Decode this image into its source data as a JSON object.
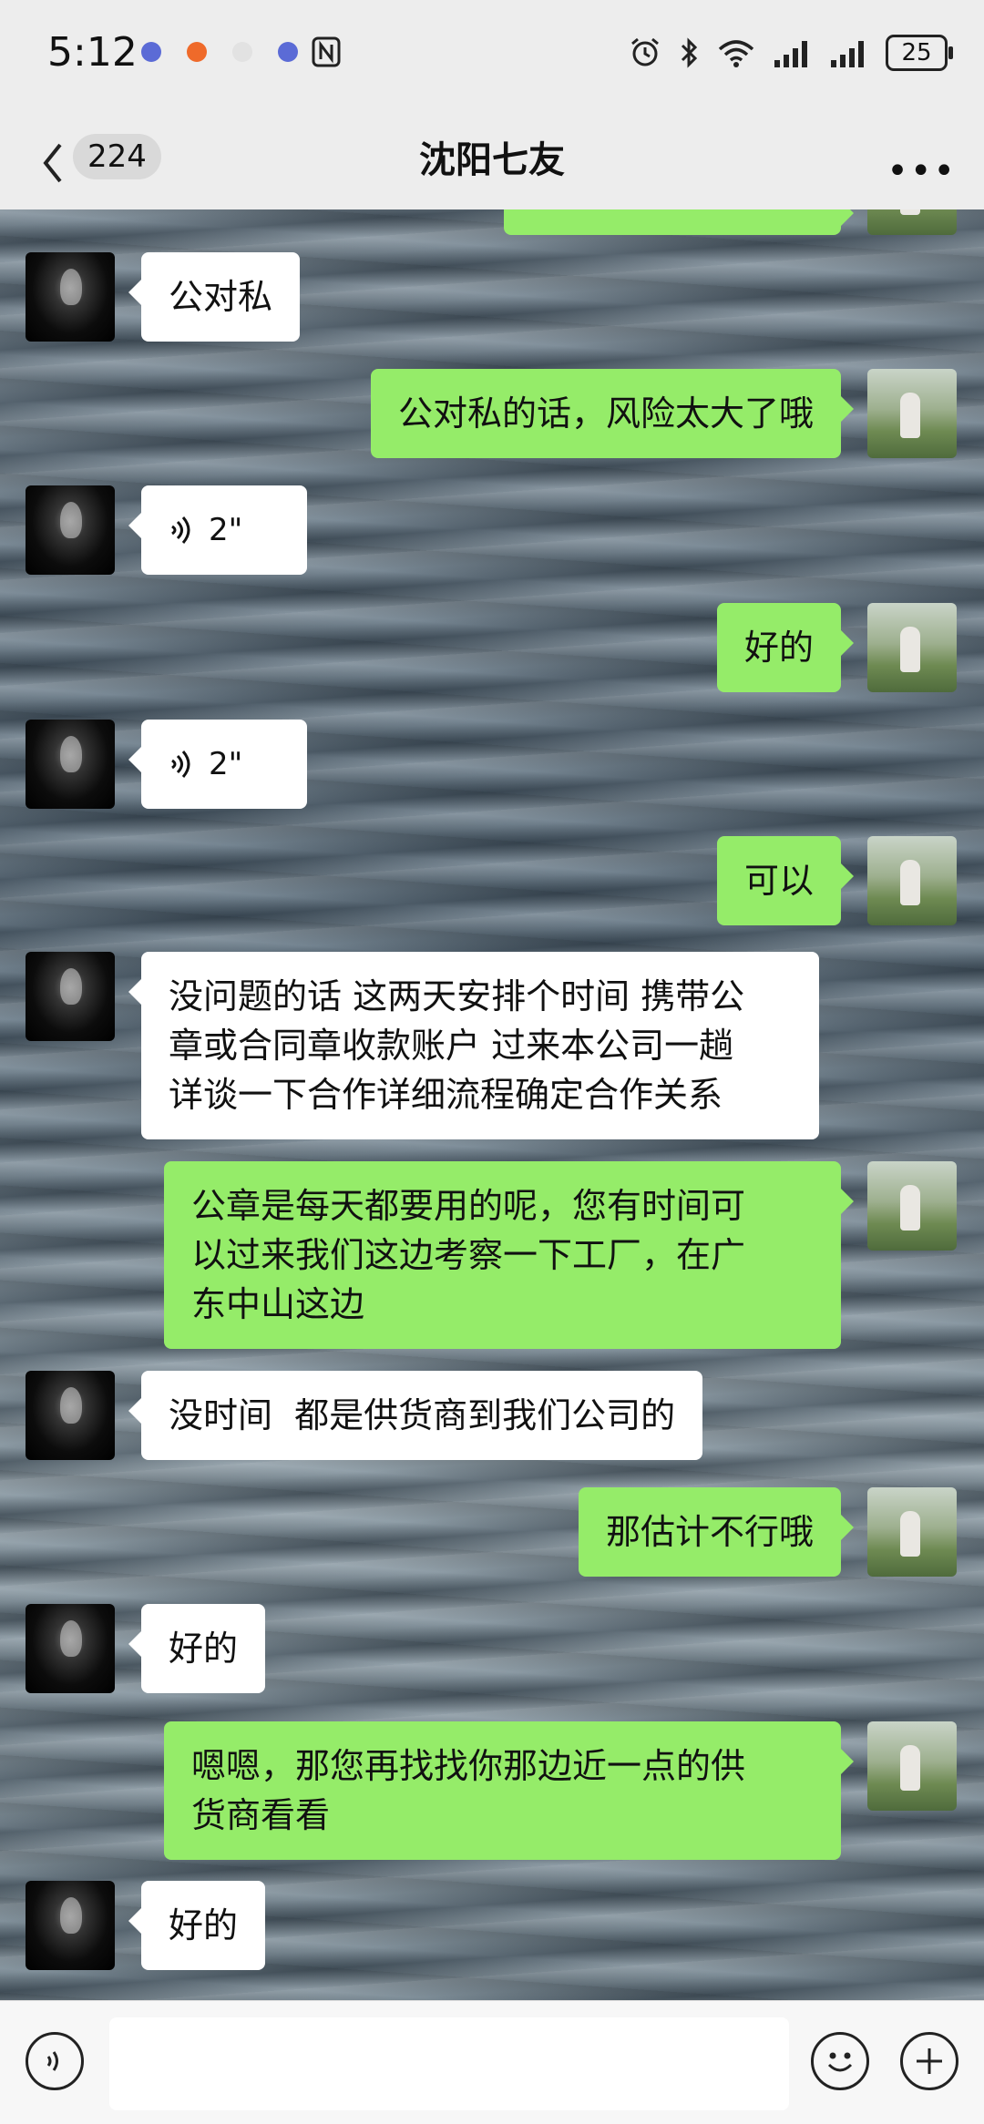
{
  "status": {
    "time": "5:12",
    "battery": "25"
  },
  "nav": {
    "unread": "224",
    "title": "沈阳七友"
  },
  "messages": [
    {
      "side": "left",
      "text": "公对私"
    },
    {
      "side": "right",
      "text": "公对私的话，风险太大了哦"
    },
    {
      "side": "left",
      "voice": "2\""
    },
    {
      "side": "right",
      "text": "好的"
    },
    {
      "side": "left",
      "voice": "2\""
    },
    {
      "side": "right",
      "text": "可以"
    },
    {
      "side": "left",
      "lines": [
        "没问题的话 这两天安排个时间 携带公",
        "章或合同章收款账户 过来本公司一趟",
        "详谈一下合作详细流程确定合作关系"
      ]
    },
    {
      "side": "right",
      "lines": [
        "公章是每天都要用的呢，您有时间可",
        "以过来我们这边考察一下工厂，在广",
        "东中山这边"
      ]
    },
    {
      "side": "left",
      "text": "没时间  都是供货商到我们公司的"
    },
    {
      "side": "right",
      "text": "那估计不行哦"
    },
    {
      "side": "left",
      "text": "好的"
    },
    {
      "side": "right",
      "lines": [
        "嗯嗯，那您再找找你那边近一点的供",
        "货商看看"
      ]
    },
    {
      "side": "left",
      "text": "好的"
    }
  ]
}
